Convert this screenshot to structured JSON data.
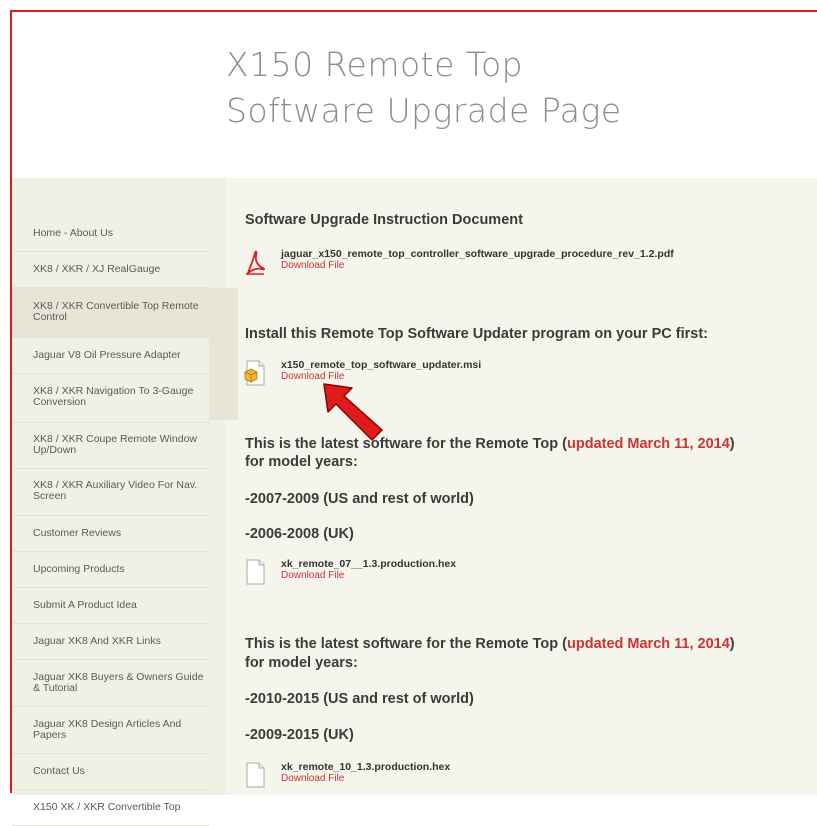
{
  "header": {
    "title_line1": "X150 Remote Top",
    "title_line2": "Software Upgrade Page"
  },
  "sidebar": {
    "items": [
      {
        "label": "Home - About Us"
      },
      {
        "label": "XK8 / XKR / XJ RealGauge"
      },
      {
        "label": "XK8 / XKR Convertible Top Remote Control",
        "active": true
      },
      {
        "label": "Jaguar V8 Oil Pressure Adapter"
      },
      {
        "label": "XK8 / XKR Navigation To 3-Gauge Conversion"
      },
      {
        "label": "XK8 / XKR Coupe Remote Window Up/Down"
      },
      {
        "label": "XK8 / XKR Auxiliary Video For Nav. Screen"
      },
      {
        "label": "Customer Reviews"
      },
      {
        "label": "Upcoming Products"
      },
      {
        "label": "Submit A Product Idea"
      },
      {
        "label": "Jaguar XK8 And XKR Links"
      },
      {
        "label": "Jaguar XK8 Buyers & Owners Guide & Tutorial"
      },
      {
        "label": "Jaguar XK8 Design Articles And Papers"
      },
      {
        "label": "Contact Us"
      },
      {
        "label": "X150 XK / XKR Convertible Top"
      }
    ]
  },
  "main": {
    "section1_heading": "Software Upgrade Instruction Document",
    "file1": {
      "name": "jaguar_x150_remote_top_controller_software_upgrade_procedure_rev_1.2.pdf",
      "link": "Download File",
      "icon": "pdf-icon"
    },
    "section2_heading": "Install this Remote Top Software Updater program on your PC first:",
    "file2": {
      "name": "x150_remote_top_software_updater.msi",
      "link": "Download File",
      "icon": "installer-icon"
    },
    "section3": {
      "line1_pre": "This is the latest software for the Remote Top (",
      "line1_hl": "updated March 11, 2014",
      "line1_post": ")",
      "line2": "for model years:",
      "years1": "-2007-2009 (US and rest of world)",
      "years2": "-2006-2008  (UK)"
    },
    "file3": {
      "name": "xk_remote_07__1.3.production.hex",
      "link": "Download File",
      "icon": "file-icon"
    },
    "section4": {
      "line1_pre": "This is the latest software for the Remote Top (",
      "line1_hl": "updated March 11, 2014",
      "line1_post": ")",
      "line2": "for model years:",
      "years1": "-2010-2015 (US and rest of world)",
      "years2": "-2009-2015 (UK)"
    },
    "file4": {
      "name": "xk_remote_10_1.3.production.hex",
      "link": "Download File",
      "icon": "file-icon"
    }
  },
  "colors": {
    "accent_red": "#c83535",
    "border_red": "#d61e1e",
    "annotation_arrow": "#e01b1b"
  }
}
